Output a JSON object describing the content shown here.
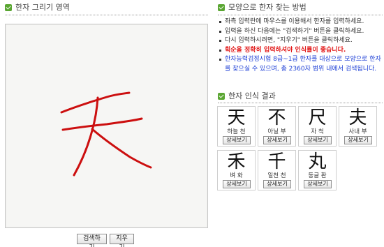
{
  "drawing": {
    "title": "한자 그리기 영역",
    "search_button": "검색하기",
    "clear_button": "지우기",
    "stroke_color": "#cc0f0f"
  },
  "howto": {
    "title": "모양으로 한자 찾는 방법",
    "items": [
      "좌측 입력란에 마우스를 이용해서 한자를 입력하세요.",
      "입력을 하신 다음에는 \"검색하기\" 버튼을 클릭하세요.",
      "다시 입력하시려면, \"지우기\" 버튼을 클릭하세요.",
      "획순을 정확히 입력하셔야 인식률이 좋습니다.",
      "한자능력검정시험 8급~1급 한자를 대상으로 모양으로 한자를 찾으실 수 있으며, 총 2360자 범위 내에서 검색됩니다."
    ],
    "warning_color": "#e21a1a",
    "info_color": "#1d3fd6"
  },
  "results": {
    "title": "한자 인식 결과",
    "detail_label": "상세보기",
    "items": [
      {
        "hanja": "天",
        "meaning": "하늘 천"
      },
      {
        "hanja": "不",
        "meaning": "아닐 부"
      },
      {
        "hanja": "尺",
        "meaning": "자 척"
      },
      {
        "hanja": "夫",
        "meaning": "사내 부"
      },
      {
        "hanja": "禾",
        "meaning": "벼 화"
      },
      {
        "hanja": "千",
        "meaning": "일천 천"
      },
      {
        "hanja": "丸",
        "meaning": "둥글 환"
      }
    ]
  }
}
